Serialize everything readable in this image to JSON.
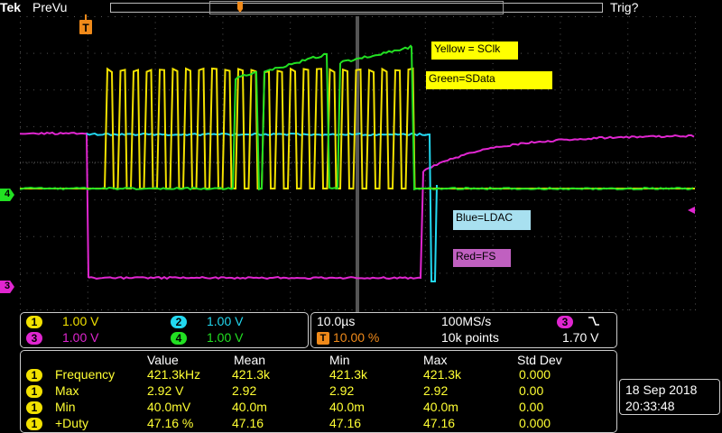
{
  "header": {
    "brand": "Tek",
    "mode": "PreVu",
    "trigger_state": "Trig?",
    "trigger_marker": "T"
  },
  "annotations": {
    "yellow": "Yellow = SClk",
    "green": "Green=SData",
    "blue": "Blue=LDAC",
    "red": "Red=FS"
  },
  "channel_markers": {
    "ch4": "4",
    "ch3": "3"
  },
  "colors": {
    "ch1": "#f2e100",
    "ch2": "#22d8f0",
    "ch3": "#e026d0",
    "ch4": "#22e022",
    "anno_yellow": "#ffff00",
    "anno_blue": "#a8e0f0",
    "anno_red": "#c060c0"
  },
  "channels": {
    "ch1": {
      "num": "1",
      "scale": "1.00 V"
    },
    "ch2": {
      "num": "2",
      "scale": "1.00 V"
    },
    "ch3": {
      "num": "3",
      "scale": "1.00 V"
    },
    "ch4": {
      "num": "4",
      "scale": "1.00 V"
    }
  },
  "timebase": {
    "horizontal_scale": "10.0µs",
    "sample_rate": "100MS/s",
    "trigger_position": "10.00 %",
    "record_length": "10k points",
    "trigger_source": "3",
    "trigger_slope_icon": "falling-edge-icon",
    "trigger_level": "1.70 V"
  },
  "measurements": {
    "headers": [
      "Value",
      "Mean",
      "Min",
      "Max",
      "Std Dev"
    ],
    "rows": [
      {
        "ch": "1",
        "name": "Frequency",
        "value": "421.3kHz",
        "mean": "421.3k",
        "min": "421.3k",
        "max": "421.3k",
        "std": "0.000"
      },
      {
        "ch": "1",
        "name": "Max",
        "value": "2.92 V",
        "mean": "2.92",
        "min": "2.92",
        "max": "2.92",
        "std": "0.00"
      },
      {
        "ch": "1",
        "name": "Min",
        "value": "40.0mV",
        "mean": "40.0m",
        "min": "40.0m",
        "max": "40.0m",
        "std": "0.00"
      },
      {
        "ch": "1",
        "name": "+Duty",
        "value": "47.16 %",
        "mean": "47.16",
        "min": "47.16",
        "max": "47.16",
        "std": "0.000"
      }
    ]
  },
  "datetime": {
    "date": "18 Sep  2018",
    "time": "20:33:48"
  }
}
